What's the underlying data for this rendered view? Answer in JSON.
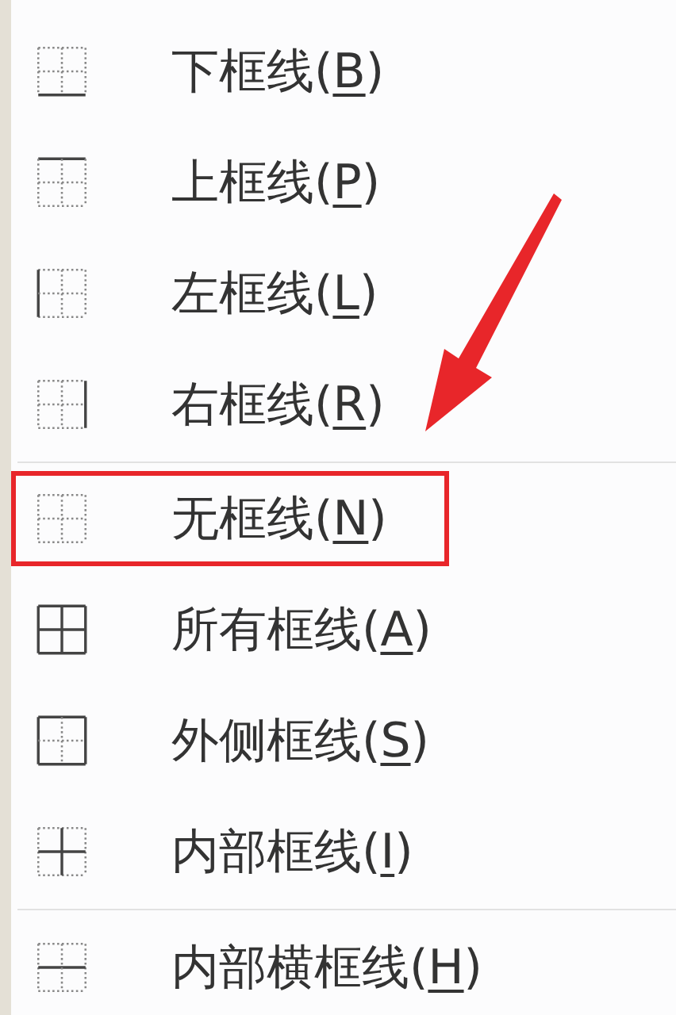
{
  "menu": {
    "items": [
      {
        "kind": "bottom",
        "text_before": "下框线(",
        "accelerator": "B",
        "text_after": ")",
        "highlighted": false
      },
      {
        "kind": "top",
        "text_before": "上框线(",
        "accelerator": "P",
        "text_after": ")",
        "highlighted": false
      },
      {
        "kind": "left",
        "text_before": "左框线(",
        "accelerator": "L",
        "text_after": ")",
        "highlighted": false
      },
      {
        "kind": "right",
        "text_before": "右框线(",
        "accelerator": "R",
        "text_after": ")",
        "highlighted": false
      },
      {
        "kind": "separator"
      },
      {
        "kind": "none",
        "text_before": "无框线(",
        "accelerator": "N",
        "text_after": ")",
        "highlighted": true
      },
      {
        "kind": "all",
        "text_before": "所有框线(",
        "accelerator": "A",
        "text_after": ")",
        "highlighted": false
      },
      {
        "kind": "outside",
        "text_before": "外侧框线(",
        "accelerator": "S",
        "text_after": ")",
        "highlighted": false
      },
      {
        "kind": "inside",
        "text_before": "内部框线(",
        "accelerator": "I",
        "text_after": ")",
        "highlighted": false
      },
      {
        "kind": "separator"
      },
      {
        "kind": "inside_horizontal",
        "text_before": "内部横框线(",
        "accelerator": "H",
        "text_after": ")",
        "highlighted": false
      }
    ]
  }
}
